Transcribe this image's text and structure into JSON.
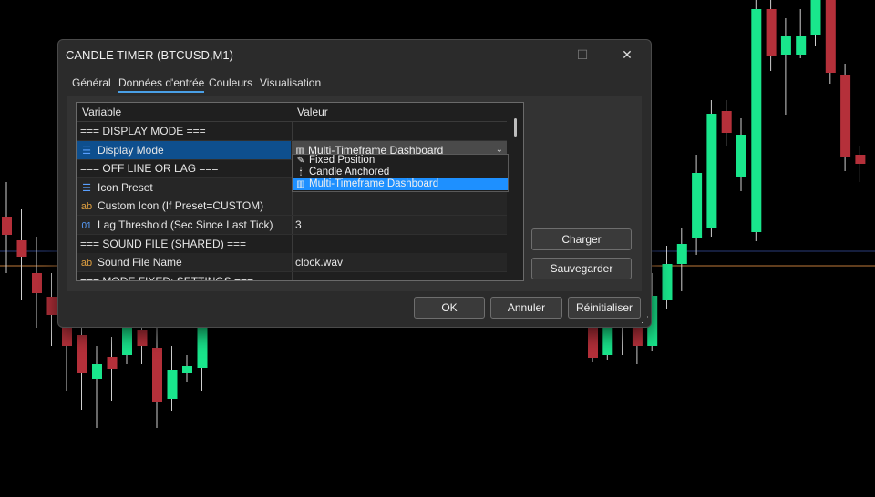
{
  "window": {
    "title": "CANDLE TIMER (BTCUSD,M1)",
    "minimize_glyph": "—",
    "maximize_glyph": "☐",
    "close_glyph": "✕"
  },
  "tabs": [
    "Général",
    "Données d'entrée",
    "Couleurs",
    "Visualisation"
  ],
  "active_tab": "Données d'entrée",
  "table": {
    "headers": {
      "variable": "Variable",
      "value": "Valeur"
    },
    "rows": [
      {
        "kind": "section",
        "variable": "=== DISPLAY MODE ===",
        "value": ""
      },
      {
        "kind": "enum",
        "icon": "enum-icon",
        "variable": "Display Mode",
        "value": "Multi-Timeframe Dashboard",
        "selected": true
      },
      {
        "kind": "section",
        "variable": "=== OFF LINE OR LAG ===",
        "value": ""
      },
      {
        "kind": "enum",
        "icon": "enum-icon",
        "variable": "Icon Preset",
        "value": ""
      },
      {
        "kind": "string",
        "icon": "ab-icon",
        "variable": "Custom Icon (If Preset=CUSTOM)",
        "value": ""
      },
      {
        "kind": "number",
        "icon": "number-icon",
        "variable": "Lag Threshold (Sec Since Last Tick)",
        "value": "3"
      },
      {
        "kind": "section",
        "variable": "=== SOUND FILE (SHARED) ===",
        "value": ""
      },
      {
        "kind": "string",
        "icon": "ab-icon",
        "variable": "Sound File Name",
        "value": "clock.wav"
      },
      {
        "kind": "section",
        "variable": "=== MODE FIXED: SETTINGS ===",
        "value": ""
      }
    ]
  },
  "dropdown": {
    "selected": "Multi-Timeframe Dashboard",
    "options": [
      {
        "label": "Fixed Position",
        "icon": "pin-icon",
        "glyph": "✎"
      },
      {
        "label": "Candle Anchored",
        "icon": "candle-icon",
        "glyph": "🕯"
      },
      {
        "label": "Multi-Timeframe Dashboard",
        "icon": "dashboard-icon",
        "glyph": "▥",
        "highlighted": true
      }
    ]
  },
  "buttons": {
    "load": "Charger",
    "save": "Sauvegarder",
    "ok": "OK",
    "cancel": "Annuler",
    "reset": "Réinitialiser"
  },
  "colors": {
    "bull": "#19e68c",
    "bear": "#b5303a",
    "selection": "#0e4f8e",
    "highlight": "#1e90ff",
    "window_bg": "#2b2b2b"
  },
  "chart_data": {
    "type": "candlestick",
    "note_series": "background candles of BTCUSD M1 chart (values in relative price units, higher = higher price)",
    "candles_left": [
      {
        "o": 258,
        "c": 238,
        "h": 200,
        "l": 300,
        "bull": false
      },
      {
        "o": 282,
        "c": 264,
        "h": 230,
        "l": 330,
        "bull": false
      },
      {
        "o": 300,
        "c": 322,
        "h": 260,
        "l": 360,
        "bull": false
      },
      {
        "o": 326,
        "c": 346,
        "h": 300,
        "l": 380,
        "bull": false
      },
      {
        "o": 340,
        "c": 380,
        "h": 320,
        "l": 430,
        "bull": false
      },
      {
        "o": 368,
        "c": 410,
        "h": 340,
        "l": 450,
        "bull": false
      },
      {
        "o": 400,
        "c": 416,
        "h": 380,
        "l": 470,
        "bull": true
      },
      {
        "o": 392,
        "c": 405,
        "h": 370,
        "l": 440,
        "bull": false
      },
      {
        "o": 345,
        "c": 390,
        "h": 320,
        "l": 400,
        "bull": true
      },
      {
        "o": 362,
        "c": 380,
        "h": 340,
        "l": 400,
        "bull": false
      },
      {
        "o": 382,
        "c": 442,
        "h": 360,
        "l": 470,
        "bull": false
      },
      {
        "o": 406,
        "c": 438,
        "h": 380,
        "l": 452,
        "bull": true
      },
      {
        "o": 402,
        "c": 410,
        "h": 390,
        "l": 420,
        "bull": true
      },
      {
        "o": 358,
        "c": 404,
        "h": 340,
        "l": 430,
        "bull": true
      }
    ],
    "candles_right": [
      {
        "o": 356,
        "c": 393,
        "h": 340,
        "l": 398,
        "bull": false
      },
      {
        "o": 345,
        "c": 390,
        "h": 330,
        "l": 396,
        "bull": true
      },
      {
        "o": 300,
        "c": 355,
        "h": 280,
        "l": 390,
        "bull": true
      },
      {
        "o": 325,
        "c": 380,
        "h": 310,
        "l": 400,
        "bull": false
      },
      {
        "o": 325,
        "c": 380,
        "h": 300,
        "l": 386,
        "bull": true
      },
      {
        "o": 290,
        "c": 330,
        "h": 270,
        "l": 340,
        "bull": true
      },
      {
        "o": 268,
        "c": 290,
        "h": 250,
        "l": 320,
        "bull": true
      },
      {
        "o": 190,
        "c": 262,
        "h": 170,
        "l": 280,
        "bull": true
      },
      {
        "o": 125,
        "c": 250,
        "h": 110,
        "l": 260,
        "bull": true
      },
      {
        "o": 122,
        "c": 146,
        "h": 110,
        "l": 160,
        "bull": false
      },
      {
        "o": 148,
        "c": 195,
        "h": 130,
        "l": 210,
        "bull": true
      },
      {
        "o": 10,
        "c": 255,
        "h": 0,
        "l": 265,
        "bull": true
      },
      {
        "o": 10,
        "c": 62,
        "h": 0,
        "l": 78,
        "bull": false
      },
      {
        "o": 60,
        "c": 40,
        "h": 20,
        "l": 126,
        "bull": true
      },
      {
        "o": 40,
        "c": 60,
        "h": 10,
        "l": 64,
        "bull": true
      },
      {
        "o": 0,
        "c": 38,
        "h": 0,
        "l": 50,
        "bull": true
      },
      {
        "o": 0,
        "c": 80,
        "h": 0,
        "l": 92,
        "bull": false
      },
      {
        "o": 82,
        "c": 172,
        "h": 70,
        "l": 188,
        "bull": false
      },
      {
        "o": 170,
        "c": 180,
        "h": 160,
        "l": 200,
        "bull": false
      }
    ],
    "hline_blue": 276,
    "hline_orange": 292
  }
}
